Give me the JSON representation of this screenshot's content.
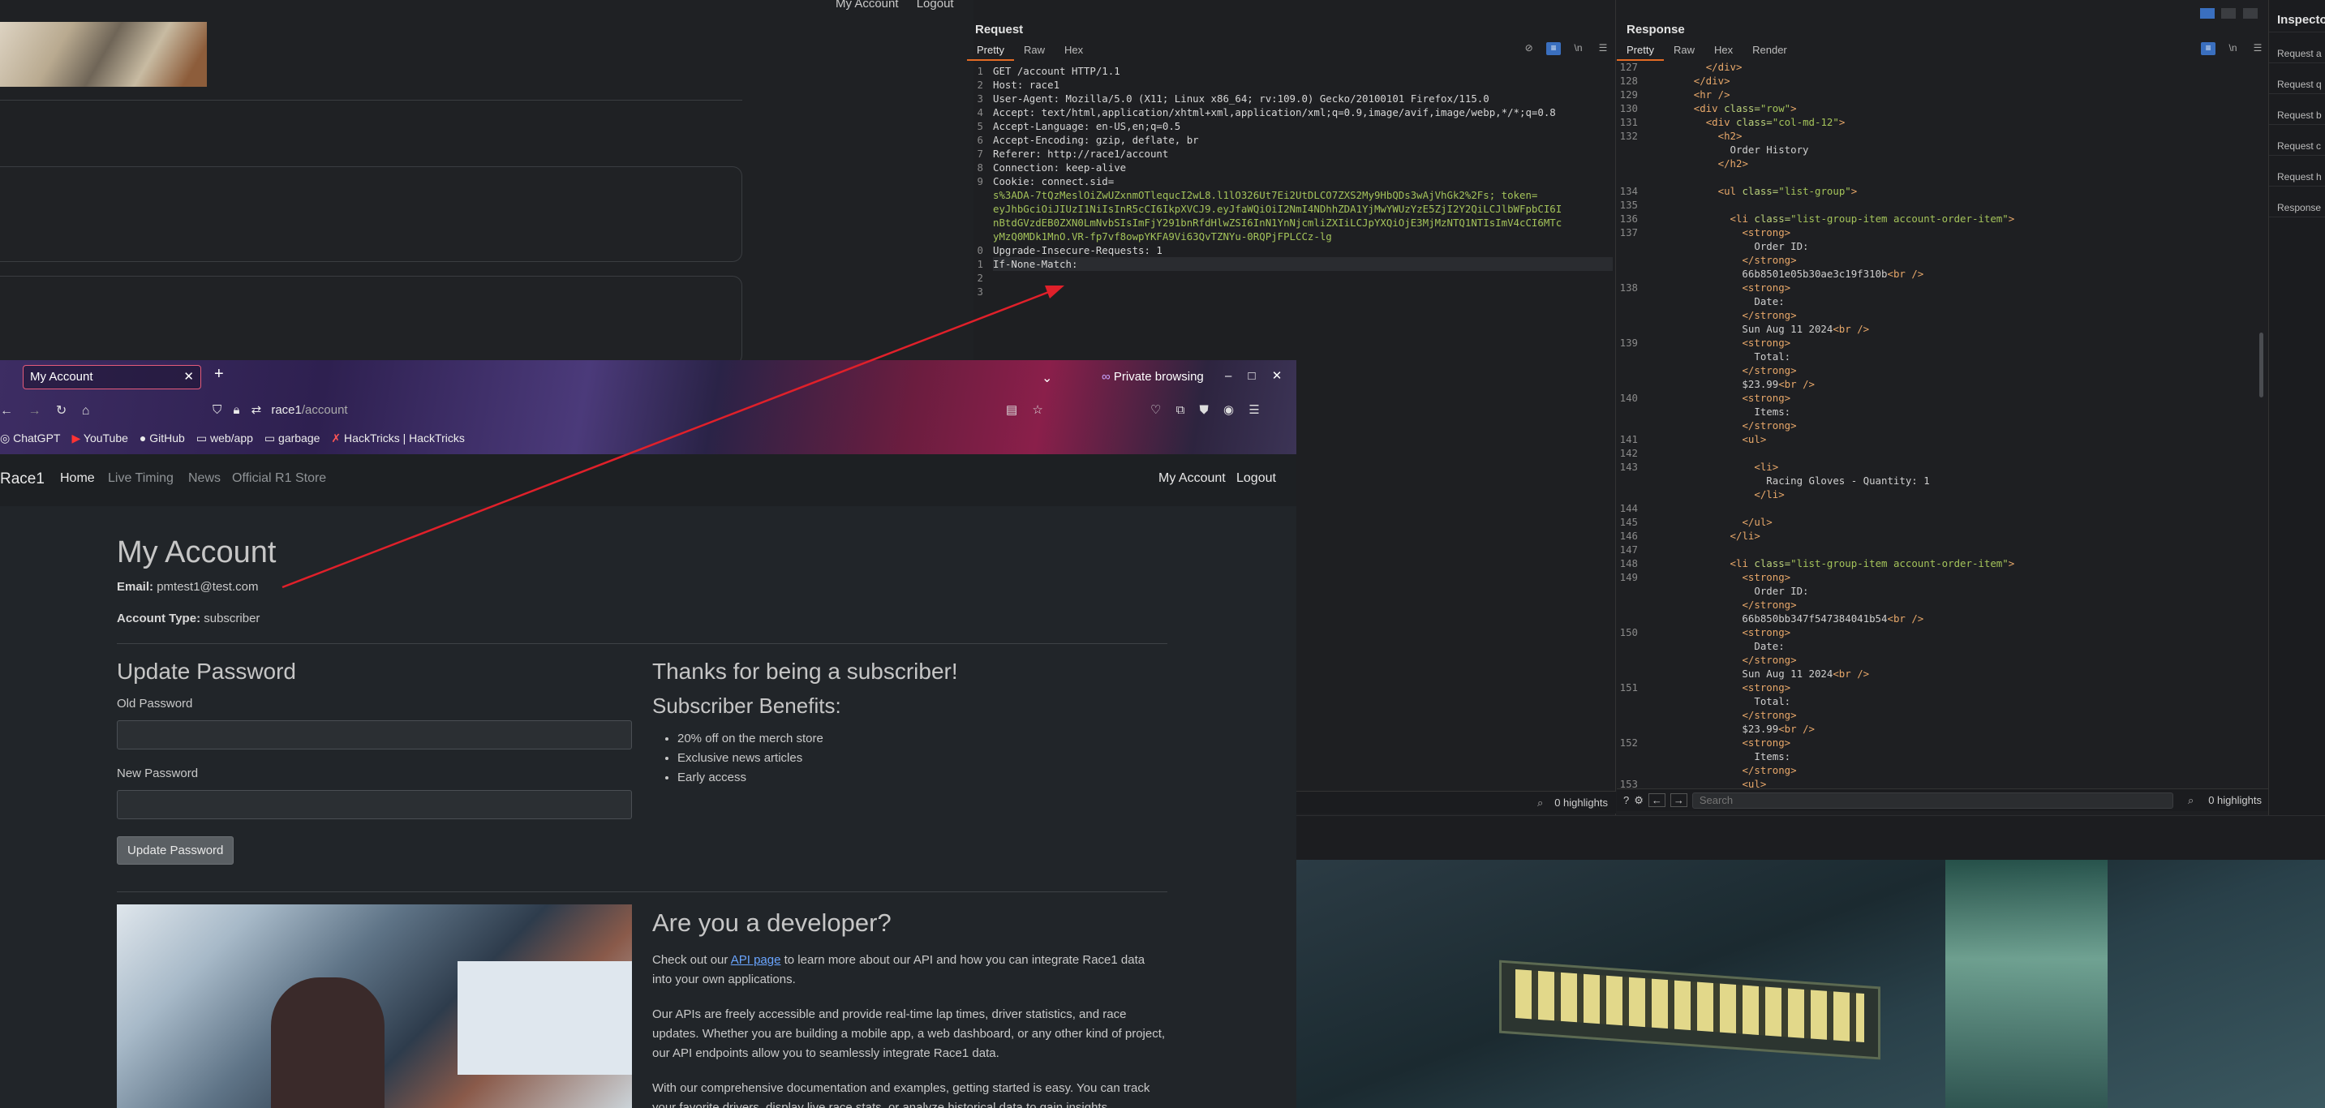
{
  "background_window": {
    "nav": [
      "My Account",
      "Logout"
    ]
  },
  "burp": {
    "request": {
      "title": "Request",
      "tabs": [
        "Pretty",
        "Raw",
        "Hex"
      ],
      "lines": [
        {
          "n": "1",
          "text": "GET /account HTTP/1.1"
        },
        {
          "n": "2",
          "text": "Host: race1"
        },
        {
          "n": "3",
          "text": "User-Agent: Mozilla/5.0 (X11; Linux x86_64; rv:109.0) Gecko/20100101 Firefox/115.0"
        },
        {
          "n": "4",
          "text": "Accept: text/html,application/xhtml+xml,application/xml;q=0.9,image/avif,image/webp,*/*;q=0.8"
        },
        {
          "n": "5",
          "text": "Accept-Language: en-US,en;q=0.5"
        },
        {
          "n": "6",
          "text": "Accept-Encoding: gzip, deflate, br"
        },
        {
          "n": "7",
          "text": "Referer: http://race1/account"
        },
        {
          "n": "8",
          "text": "Connection: keep-alive"
        },
        {
          "n": "9",
          "text": "Cookie: connect.sid="
        },
        {
          "n": "",
          "text": "s%3ADA-7tQzMeslOiZwUZxnmOTlequcI2wL8.l1lO326Ut7Ei2UtDLCO7ZXS2My9HbQDs3wAjVhGk2%2Fs; token="
        },
        {
          "n": "",
          "text": "eyJhbGciOiJIUzI1NiIsInR5cCI6IkpXVCJ9.eyJfaWQiOiI2NmI4NDhhZDA1YjMwYWUzYzE5ZjI2Y2QiLCJlbWFpbCI6I"
        },
        {
          "n": "",
          "text": "nBtdGVzdEB0ZXN0LmNvbSIsImFjY291bnRfdHlwZSI6InN1YnNjcmliZXIiLCJpYXQiOjE3MjMzNTQ1NTIsImV4cCI6MTc"
        },
        {
          "n": "",
          "text": "yMzQ0MDk1MnO.VR-fp7vf8owpYKFA9Vi63QvTZNYu-0RQPjFPLCCz-lg"
        },
        {
          "n": "0",
          "text": "Upgrade-Insecure-Requests: 1"
        },
        {
          "n": "1",
          "text": "If-None-Match:"
        },
        {
          "n": "2",
          "text": ""
        },
        {
          "n": "3",
          "text": ""
        }
      ],
      "highlights": "0 highlights"
    },
    "response": {
      "title": "Response",
      "tabs": [
        "Pretty",
        "Raw",
        "Hex",
        "Render"
      ],
      "lines": [
        {
          "n": "127",
          "text": "        </div>"
        },
        {
          "n": "128",
          "text": "      </div>"
        },
        {
          "n": "129",
          "text": "      <hr />"
        },
        {
          "n": "130",
          "text": "      <div class=\"row\">"
        },
        {
          "n": "131",
          "text": "        <div class=\"col-md-12\">"
        },
        {
          "n": "132",
          "text": "          <h2>"
        },
        {
          "n": "",
          "text": "            Order History"
        },
        {
          "n": "",
          "text": "          </h2>"
        },
        {
          "n": "",
          "text": ""
        },
        {
          "n": "134",
          "text": "          <ul class=\"list-group\">"
        },
        {
          "n": "135",
          "text": ""
        },
        {
          "n": "136",
          "text": "            <li class=\"list-group-item account-order-item\">"
        },
        {
          "n": "137",
          "text": "              <strong>"
        },
        {
          "n": "",
          "text": "                Order ID:"
        },
        {
          "n": "",
          "text": "              </strong>"
        },
        {
          "n": "",
          "text": "              66b8501e05b30ae3c19f310b<br />"
        },
        {
          "n": "138",
          "text": "              <strong>"
        },
        {
          "n": "",
          "text": "                Date:"
        },
        {
          "n": "",
          "text": "              </strong>"
        },
        {
          "n": "",
          "text": "              Sun Aug 11 2024<br />"
        },
        {
          "n": "139",
          "text": "              <strong>"
        },
        {
          "n": "",
          "text": "                Total:"
        },
        {
          "n": "",
          "text": "              </strong>"
        },
        {
          "n": "",
          "text": "              $23.99<br />"
        },
        {
          "n": "140",
          "text": "              <strong>"
        },
        {
          "n": "",
          "text": "                Items:"
        },
        {
          "n": "",
          "text": "              </strong>"
        },
        {
          "n": "141",
          "text": "              <ul>"
        },
        {
          "n": "142",
          "text": ""
        },
        {
          "n": "143",
          "text": "                <li>"
        },
        {
          "n": "",
          "text": "                  Racing Gloves - Quantity: 1"
        },
        {
          "n": "",
          "text": "                </li>"
        },
        {
          "n": "144",
          "text": ""
        },
        {
          "n": "145",
          "text": "              </ul>"
        },
        {
          "n": "146",
          "text": "            </li>"
        },
        {
          "n": "147",
          "text": ""
        },
        {
          "n": "148",
          "text": "            <li class=\"list-group-item account-order-item\">"
        },
        {
          "n": "149",
          "text": "              <strong>"
        },
        {
          "n": "",
          "text": "                Order ID:"
        },
        {
          "n": "",
          "text": "              </strong>"
        },
        {
          "n": "",
          "text": "              66b850bb347f547384041b54<br />"
        },
        {
          "n": "150",
          "text": "              <strong>"
        },
        {
          "n": "",
          "text": "                Date:"
        },
        {
          "n": "",
          "text": "              </strong>"
        },
        {
          "n": "",
          "text": "              Sun Aug 11 2024<br />"
        },
        {
          "n": "151",
          "text": "              <strong>"
        },
        {
          "n": "",
          "text": "                Total:"
        },
        {
          "n": "",
          "text": "              </strong>"
        },
        {
          "n": "",
          "text": "              $23.99<br />"
        },
        {
          "n": "152",
          "text": "              <strong>"
        },
        {
          "n": "",
          "text": "                Items:"
        },
        {
          "n": "",
          "text": "              </strong>"
        },
        {
          "n": "153",
          "text": "              <ul>"
        }
      ],
      "search_placeholder": "Search",
      "highlights": "0 highlights"
    },
    "inspector": {
      "title": "Inspecto",
      "items": [
        "Request a",
        "Request q",
        "Request b",
        "Request c",
        "Request h",
        "Response"
      ]
    }
  },
  "firefox": {
    "tab_title": "My Account",
    "private_label": "Private browsing",
    "url_host": "race1",
    "url_path": "/account",
    "bookmarks": [
      "ChatGPT",
      "YouTube",
      "GitHub",
      "web/app",
      "garbage",
      "HackTricks | HackTricks"
    ]
  },
  "site": {
    "brand": "Race1",
    "nav": [
      "Home",
      "Live Timing",
      "News",
      "Official R1 Store"
    ],
    "nav_right": [
      "My Account",
      "Logout"
    ],
    "heading": "My Account",
    "email_label": "Email:",
    "email_value": "pmtest1@test.com",
    "account_type_label": "Account Type:",
    "account_type_value": "subscriber",
    "update_password_heading": "Update Password",
    "old_password_label": "Old Password",
    "new_password_label": "New Password",
    "update_button": "Update Password",
    "thanks_heading": "Thanks for being a subscriber!",
    "benefits_heading": "Subscriber Benefits:",
    "benefits": [
      "20% off on the merch store",
      "Exclusive news articles",
      "Early access"
    ],
    "developer_heading": "Are you a developer?",
    "dev_p1_before": "Check out our ",
    "dev_p1_link": "API page",
    "dev_p1_after": " to learn more about our API and how you can integrate Race1 data into your own applications.",
    "dev_p2": "Our APIs are freely accessible and provide real-time lap times, driver statistics, and race updates. Whether you are building a mobile app, a web dashboard, or any other kind of project, our API endpoints allow you to seamlessly integrate Race1 data.",
    "dev_p3": "With our comprehensive documentation and examples, getting started is easy. You can track your favorite drivers, display live race stats, or analyze historical data to gain insights"
  },
  "colors": {
    "accent_tab": "#e46b24",
    "annotation_arrow": "#e0202a",
    "link": "#6aa5ff"
  }
}
